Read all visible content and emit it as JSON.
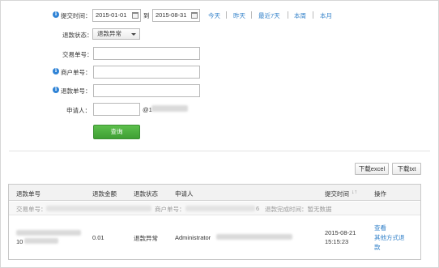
{
  "filters": {
    "submit_time": {
      "label": "提交时间：",
      "start": "2015-01-01",
      "to": "到",
      "end": "2015-08-31",
      "quick_ranges": [
        "今天",
        "昨天",
        "最近7天",
        "本周",
        "本月"
      ]
    },
    "refund_status": {
      "label": "退款状态：",
      "selected": "退款异常"
    },
    "transaction_no": {
      "label": "交易单号：",
      "value": ""
    },
    "merchant_no": {
      "label": "商户单号：",
      "value": ""
    },
    "refund_no": {
      "label": "退款单号：",
      "value": ""
    },
    "applicant": {
      "label": "申请人：",
      "value": "",
      "suffix": "@1"
    },
    "query_button": "查询"
  },
  "downloads": {
    "excel": "下载excel",
    "txt": "下载txt"
  },
  "table": {
    "columns": [
      "退款单号",
      "退款金额",
      "退款状态",
      "申请人",
      "提交时间",
      "操作"
    ],
    "sort_glyph": "↓↑",
    "sub_header": {
      "transaction_no_label": "交易单号：",
      "merchant_no_label": "商户单号：",
      "merchant_no_tail": "6",
      "refund_complete": "退款完成时间：暂无数据"
    },
    "rows": [
      {
        "refund_no_prefix": "10",
        "amount": "0.01",
        "status": "退款异常",
        "applicant": "Administrator",
        "submit_date": "2015-08-21",
        "submit_time": "15:15:23",
        "actions": [
          "查看",
          "其他方式退",
          "款"
        ]
      }
    ]
  },
  "colors": {
    "link": "#2f7fc8",
    "info_icon": "#2f83d6",
    "primary_button": "#4caf3e"
  }
}
